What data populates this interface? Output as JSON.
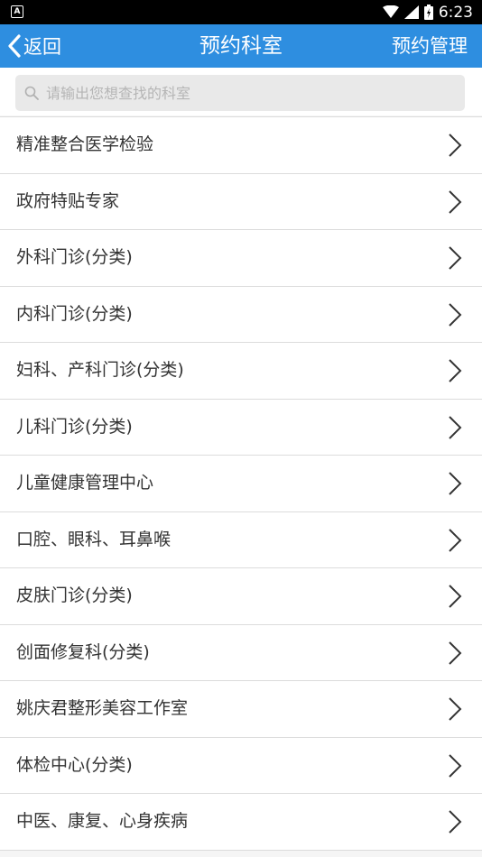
{
  "status_bar": {
    "app_icon_letter": "A",
    "time": "6:23"
  },
  "header": {
    "back_label": "返回",
    "title": "预约科室",
    "manage_label": "预约管理"
  },
  "search": {
    "placeholder": "请输出您想查找的科室",
    "value": ""
  },
  "departments": [
    "精准整合医学检验",
    "政府特贴专家",
    "外科门诊(分类)",
    "内科门诊(分类)",
    "妇科、产科门诊(分类)",
    "儿科门诊(分类)",
    "儿童健康管理中心",
    "口腔、眼科、耳鼻喉",
    "皮肤门诊(分类)",
    "创面修复科(分类)",
    "姚庆君整形美容工作室",
    "体检中心(分类)",
    "中医、康复、心身疾病"
  ],
  "colors": {
    "header_bg": "#2e8ee0",
    "status_bg": "#000000",
    "search_bg": "#e9e9e9",
    "divider": "#dcdcdc"
  }
}
